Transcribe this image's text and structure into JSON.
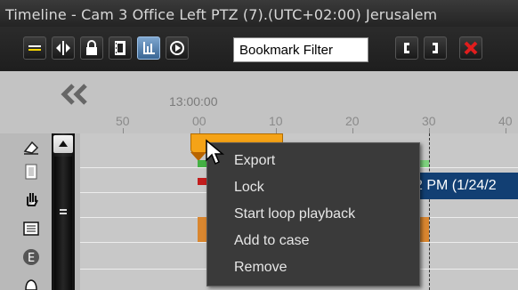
{
  "window": {
    "title": "Timeline - Cam 3 Office Left PTZ (7).(UTC+02:00) Jerusalem"
  },
  "toolbar": {
    "buttons": [
      {
        "icon": "bookmark-list-icon"
      },
      {
        "icon": "fit-tracks-icon"
      },
      {
        "icon": "lock-icon"
      },
      {
        "icon": "export-film-icon"
      },
      {
        "icon": "histogram-icon",
        "active": true
      },
      {
        "icon": "clock-play-icon"
      }
    ],
    "filter_value": "Bookmark Filter",
    "right_buttons": [
      {
        "icon": "mark-in-icon"
      },
      {
        "icon": "mark-out-icon"
      },
      {
        "icon": "clear-marks-icon"
      }
    ]
  },
  "ruler": {
    "time_label": "13:00:00",
    "ticks": [
      "50",
      "00",
      "10",
      "20",
      "30",
      "40"
    ]
  },
  "track": {
    "overlay_text": "2 PM (1/24/2"
  },
  "context_menu": {
    "items": [
      "Export",
      "Lock",
      "Start loop playback",
      "Add to case",
      "Remove"
    ]
  },
  "colors": {
    "bookmark": "#f5a317",
    "selection": "#123f73",
    "menu_bg": "#3a3a3a"
  }
}
